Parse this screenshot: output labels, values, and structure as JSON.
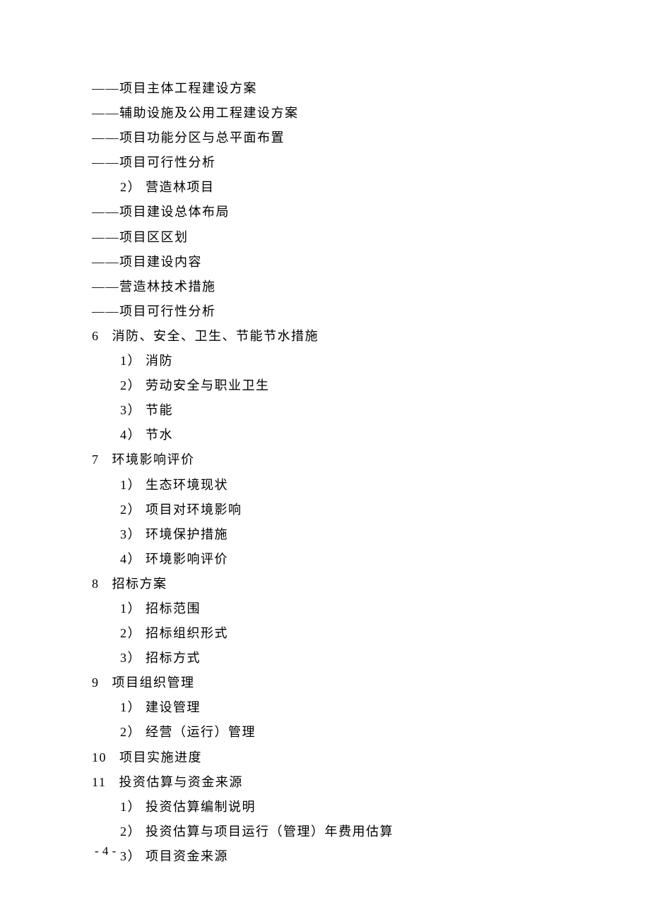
{
  "lines": [
    {
      "cls": "l1",
      "text": "——项目主体工程建设方案"
    },
    {
      "cls": "l1",
      "text": "——辅助设施及公用工程建设方案"
    },
    {
      "cls": "l1",
      "text": "——项目功能分区与总平面布置"
    },
    {
      "cls": "l1",
      "text": "——项目可行性分析"
    },
    {
      "cls": "l2",
      "text": "2） 营造林项目"
    },
    {
      "cls": "l1",
      "text": "——项目建设总体布局"
    },
    {
      "cls": "l1",
      "text": "——项目区区划"
    },
    {
      "cls": "l1",
      "text": "——项目建设内容"
    },
    {
      "cls": "l1",
      "text": "——营造林技术措施"
    },
    {
      "cls": "l1",
      "text": "——项目可行性分析"
    },
    {
      "cls": "l1",
      "text": "6   消防、安全、卫生、节能节水措施"
    },
    {
      "cls": "l3",
      "text": "1） 消防"
    },
    {
      "cls": "l3",
      "text": "2） 劳动安全与职业卫生"
    },
    {
      "cls": "l3",
      "text": "3） 节能"
    },
    {
      "cls": "l3",
      "text": "4） 节水"
    },
    {
      "cls": "l1",
      "text": "7   环境影响评价"
    },
    {
      "cls": "l3",
      "text": "1） 生态环境现状"
    },
    {
      "cls": "l3",
      "text": "2） 项目对环境影响"
    },
    {
      "cls": "l3",
      "text": "3） 环境保护措施"
    },
    {
      "cls": "l3",
      "text": "4） 环境影响评价"
    },
    {
      "cls": "l1",
      "text": "8   招标方案"
    },
    {
      "cls": "l3",
      "text": "1） 招标范围"
    },
    {
      "cls": "l3",
      "text": "2） 招标组织形式"
    },
    {
      "cls": "l3",
      "text": "3） 招标方式"
    },
    {
      "cls": "l1",
      "text": "9   项目组织管理"
    },
    {
      "cls": "l3",
      "text": "1） 建设管理"
    },
    {
      "cls": "l3",
      "text": "2） 经营（运行）管理"
    },
    {
      "cls": "l1",
      "text": "10   项目实施进度"
    },
    {
      "cls": "l1",
      "text": "11   投资估算与资金来源"
    },
    {
      "cls": "l3",
      "text": "1） 投资估算编制说明"
    },
    {
      "cls": "l3",
      "text": "2） 投资估算与项目运行（管理）年费用估算"
    },
    {
      "cls": "l3",
      "text": "3） 项目资金来源"
    }
  ],
  "page_number": "- 4 -"
}
